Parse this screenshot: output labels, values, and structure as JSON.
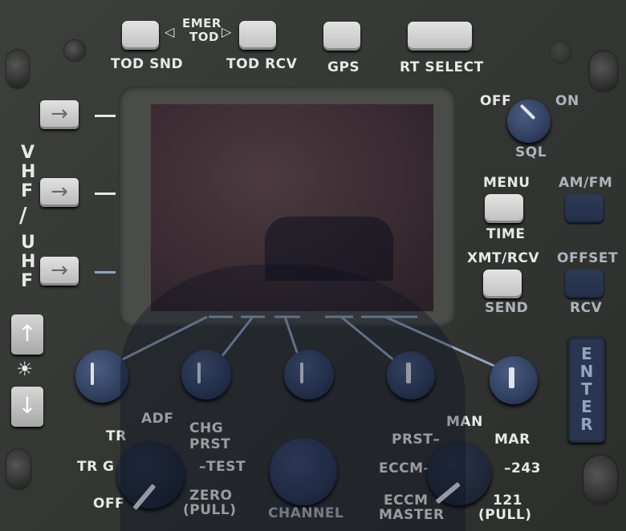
{
  "top_buttons": {
    "tod_snd": "TOD SND",
    "emer": "EMER",
    "tod": "TOD",
    "tod_rcv": "TOD RCV",
    "gps": "GPS",
    "rt_select": "RT SELECT"
  },
  "side": {
    "vhf_v": "V",
    "vhf_h": "H",
    "vhf_f": "F",
    "slash": "/",
    "uhf_u": "U",
    "uhf_h": "H",
    "uhf_f": "F",
    "arrow_right": "→",
    "arrow_up": "↑",
    "arrow_down": "↓",
    "bulb": "☀"
  },
  "right": {
    "sql_off": "OFF",
    "sql_on": "ON",
    "sql": "SQL",
    "menu": "MENU",
    "time": "TIME",
    "am_fm": "AM/FM",
    "xmt_rcv": "XMT/RCV",
    "send": "SEND",
    "offset": "OFFSET",
    "rcv": "RCV",
    "enter": "ENTER"
  },
  "mode_knob": {
    "adf": "ADF",
    "tr_upper": "TR",
    "tr_left": "TR",
    "g": "G",
    "chg": "CHG",
    "prst": "PRST",
    "test": "TEST",
    "zero": "ZERO",
    "pull": "(PULL)",
    "off": "OFF"
  },
  "channel": "CHANNEL",
  "freq_knob": {
    "man": "MAN",
    "prst": "PRST",
    "mar": "MAR",
    "eccm": "ECCM",
    "f243": "243",
    "eccm2": "ECCM",
    "master": "MASTER",
    "f121": "121",
    "pull": "(PULL)"
  }
}
